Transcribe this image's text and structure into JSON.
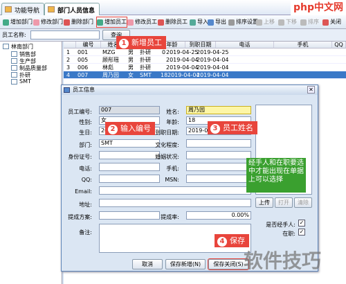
{
  "tabs": [
    {
      "label": "功能导航"
    },
    {
      "label": "部门人员信息"
    }
  ],
  "toolbar": {
    "items": [
      "增加部门",
      "修改部门",
      "删除部门",
      "增加员工",
      "修改员工",
      "删除员工",
      "导入",
      "导出",
      "排序设置",
      "上移",
      "下移",
      "排序",
      "关闭"
    ]
  },
  "search": {
    "label": "员工名称:",
    "button": "查询"
  },
  "tree": {
    "root": "林南部门",
    "children": [
      "销售部",
      "生产部",
      "制品质量部",
      "扑研",
      "SMT"
    ]
  },
  "grid": {
    "headers": [
      "编号",
      "姓名",
      "性别",
      "年龄",
      "生日",
      "到职日期",
      "电话",
      "手机",
      "QQ"
    ],
    "rows": [
      {
        "n": "1",
        "id": "001",
        "name": "MZG",
        "sex": "男",
        "dept": "扑研",
        "age": "0",
        "birth": "2019-04-25",
        "join": "2019-04-25"
      },
      {
        "n": "2",
        "id": "005",
        "name": "顾彤瑶",
        "sex": "男",
        "dept": "扑研",
        "age": "",
        "birth": "2019-04-04",
        "join": "2019-04-04"
      },
      {
        "n": "3",
        "id": "006",
        "name": "林彪",
        "sex": "男",
        "dept": "扑研",
        "age": "",
        "birth": "2019-04-04",
        "join": "2019-04-04"
      },
      {
        "n": "4",
        "id": "007",
        "name": "周乃园",
        "sex": "女",
        "dept": "SMT",
        "age": "18",
        "birth": "2019-04-04",
        "join": "2019-04-04"
      }
    ]
  },
  "dialog": {
    "title": "员工信息",
    "emp_no_label": "员工编号:",
    "emp_no": "007",
    "name_label": "姓名:",
    "name": "周乃园",
    "sex_label": "性别:",
    "sex": "女",
    "age_label": "年龄:",
    "age": "18",
    "birth_label": "生日:",
    "birth": "2019-04-04",
    "join_label": "到职日期:",
    "join": "2019-04-04",
    "dept_label": "部门:",
    "dept": "SMT",
    "edu_label": "文化程度:",
    "id_label": "身份证号:",
    "marital_label": "婚姻状况:",
    "phone_label": "电话:",
    "mobile_label": "手机:",
    "qq_label": "QQ:",
    "msn_label": "MSN:",
    "email_label": "Email:",
    "addr_label": "地址:",
    "commission_label": "提成方案:",
    "commission_rate_label": "提成率:",
    "commission_rate": "0.00%",
    "note_label": "备注:",
    "upload_btn": "上传",
    "open_btn": "打开",
    "clear_btn": "清除",
    "is_handler_label": "是否经手人:",
    "status_label": "在职:",
    "btn_close": "取消",
    "btn_save_new": "保存新增(N)",
    "btn_save_close": "保存关闭(S)"
  },
  "callouts": {
    "c1": {
      "num": "1",
      "text": "新增员工"
    },
    "c2": {
      "num": "2",
      "text": "输入编号"
    },
    "c3": {
      "num": "3",
      "text": "员工姓名"
    },
    "c4": {
      "num": "4",
      "text": "保存"
    },
    "note": "经手人和在职要选中才能出现在单据上可以选择"
  },
  "watermark": {
    "text": "软件技巧",
    "logo": "php中文网"
  },
  "colors": {
    "accent": "#e8453c",
    "note": "#3aa02f",
    "selected": "#3a78c7"
  }
}
